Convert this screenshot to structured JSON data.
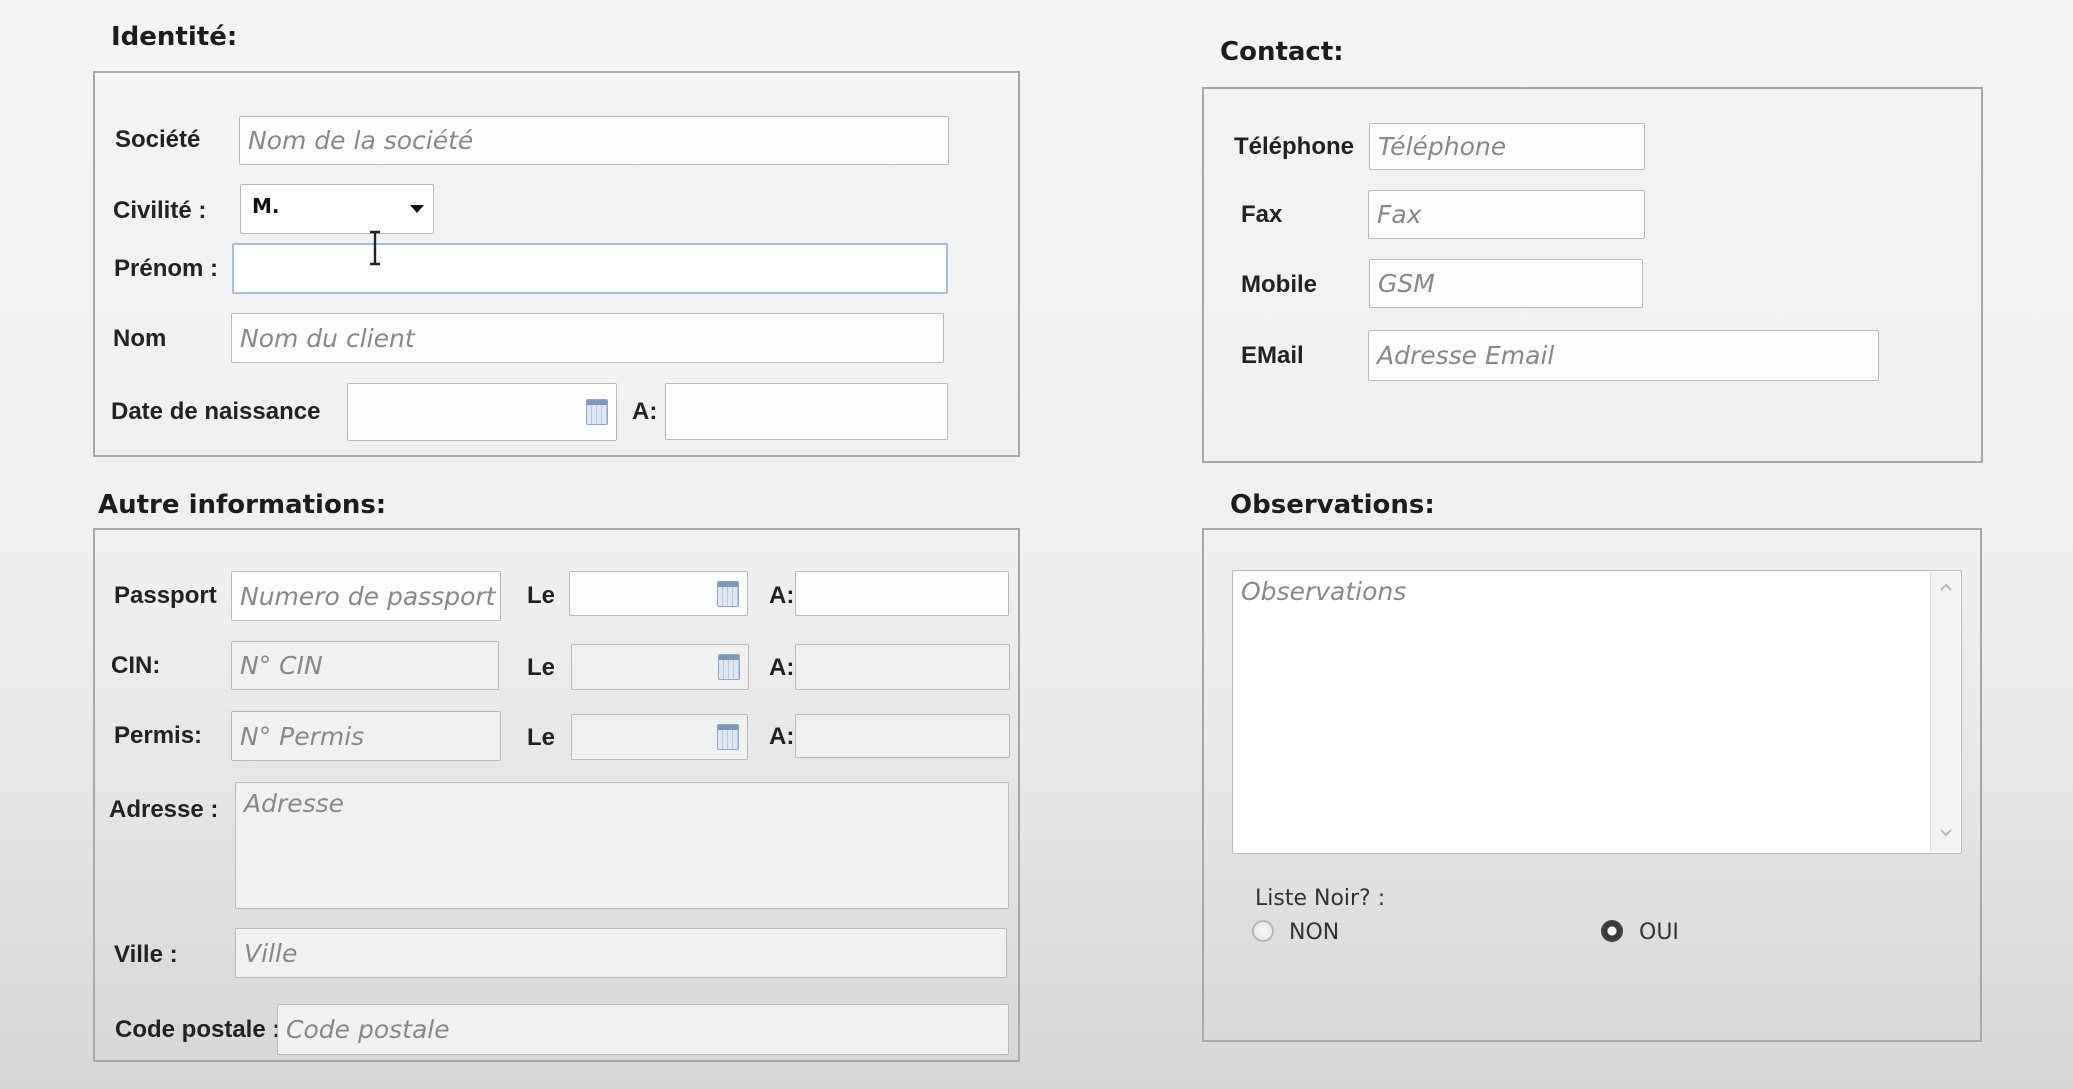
{
  "sections": {
    "identite": "Identité:",
    "contact": "Contact:",
    "autre": "Autre informations:",
    "observations": "Observations:"
  },
  "identite": {
    "societe_label": "Société",
    "societe_placeholder": "Nom de la société",
    "civilite_label": "Civilité :",
    "civilite_value": "M.",
    "prenom_label": "Prénom :",
    "prenom_value": "",
    "nom_label": "Nom",
    "nom_placeholder": "Nom du client",
    "naissance_label": "Date de naissance",
    "naissance_value": "",
    "a_label": "A:",
    "a_value": ""
  },
  "contact": {
    "telephone_label": "Téléphone",
    "telephone_placeholder": "Téléphone",
    "fax_label": "Fax",
    "fax_placeholder": "Fax",
    "mobile_label": "Mobile",
    "mobile_placeholder": "GSM",
    "email_label": "EMail",
    "email_placeholder": "Adresse Email"
  },
  "autre": {
    "passport_label": "Passport",
    "passport_placeholder": "Numero de passport",
    "cin_label": "CIN:",
    "cin_placeholder": "N° CIN",
    "permis_label": "Permis:",
    "permis_placeholder": "N° Permis",
    "le_label": "Le",
    "a_label": "A:",
    "adresse_label": "Adresse :",
    "adresse_placeholder": "Adresse",
    "ville_label": "Ville :",
    "ville_placeholder": "Ville",
    "code_label": "Code postale :",
    "code_placeholder": "Code postale"
  },
  "observations": {
    "placeholder": "Observations",
    "liste_noir_label": "Liste Noir?  :",
    "non_label": "NON",
    "oui_label": "OUI",
    "liste_noir_selected": "OUI"
  },
  "icons": [
    "calendar-icon",
    "chevron-down-icon",
    "text-cursor-icon",
    "scroll-up-arrow-icon",
    "scroll-down-arrow-icon"
  ]
}
